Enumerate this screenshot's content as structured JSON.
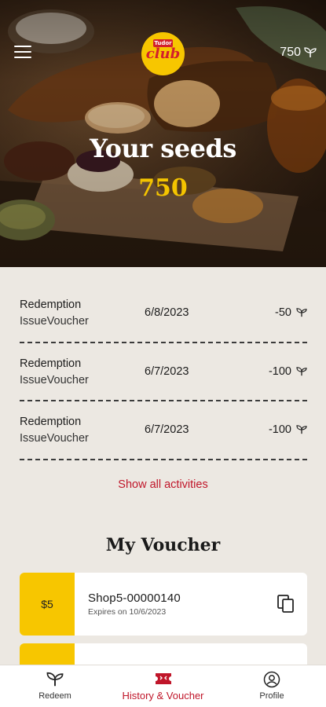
{
  "header": {
    "brand_tag": "Tudor",
    "logo_text": "club",
    "seed_balance": "750",
    "seed_icon": "sprout-icon"
  },
  "hero": {
    "title": "Your seeds",
    "value": "750"
  },
  "activities": [
    {
      "type": "Redemption",
      "sub": "IssueVoucher",
      "date": "6/8/2023",
      "amount": "-50"
    },
    {
      "type": "Redemption",
      "sub": "IssueVoucher",
      "date": "6/7/2023",
      "amount": "-100"
    },
    {
      "type": "Redemption",
      "sub": "IssueVoucher",
      "date": "6/7/2023",
      "amount": "-100"
    }
  ],
  "show_all_label": "Show all activities",
  "vouchers_section": {
    "title": "My Voucher",
    "items": [
      {
        "value": "$5",
        "code": "Shop5-00000140",
        "expires": "Expires on 10/6/2023"
      },
      {
        "value": "",
        "code": "",
        "expires": ""
      }
    ]
  },
  "nav": {
    "items": [
      {
        "label": "Redeem",
        "icon": "sprout-icon"
      },
      {
        "label": "History & Voucher",
        "icon": "ticket-icon",
        "active": true
      },
      {
        "label": "Profile",
        "icon": "profile-icon"
      }
    ]
  },
  "colors": {
    "accent_red": "#c0162a",
    "brand_yellow": "#f7c600",
    "background": "#ece8e2"
  }
}
